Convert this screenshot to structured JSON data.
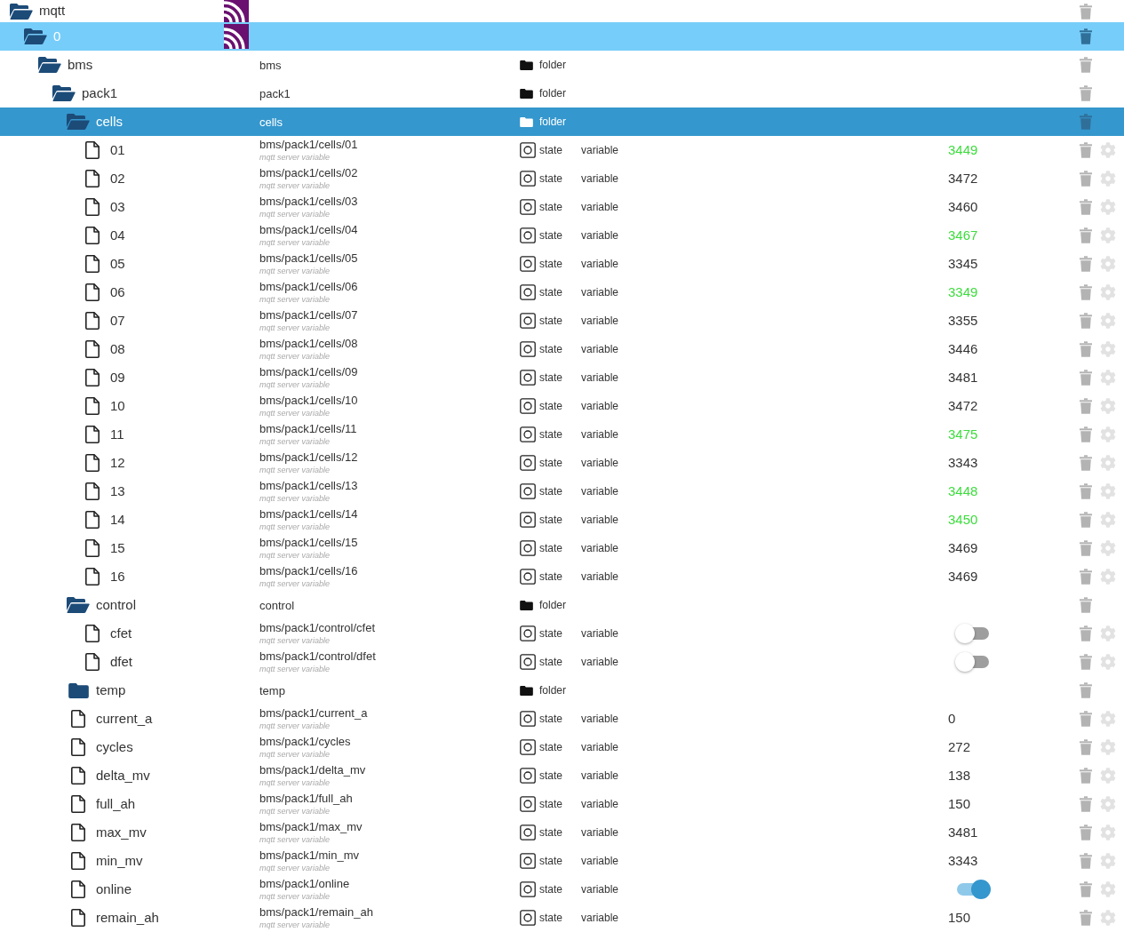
{
  "tree": [
    {
      "name": "mqtt",
      "kind": "adapter",
      "selected": false,
      "expanded": true,
      "children": [
        {
          "name": "0",
          "kind": "instance",
          "selected": false,
          "expanded": true,
          "children": [
            {
              "name": "bms",
              "kind": "folder",
              "selected": false,
              "expanded": true,
              "id": "bms",
              "type": "folder",
              "children": [
                {
                  "name": "pack1",
                  "kind": "folder",
                  "selected": false,
                  "expanded": true,
                  "id": "pack1",
                  "type": "folder",
                  "children": [
                    {
                      "name": "cells",
                      "kind": "folder",
                      "selected": true,
                      "expanded": true,
                      "id": "cells",
                      "type": "folder",
                      "children": [
                        {
                          "name": "01",
                          "kind": "state",
                          "selected": false,
                          "id": "bms/pack1/cells/01",
                          "description": "mqtt server variable",
                          "type": "state",
                          "role": "variable",
                          "value": {
                            "kind": "text",
                            "text": "3449",
                            "highlighted": true
                          }
                        },
                        {
                          "name": "02",
                          "kind": "state",
                          "selected": false,
                          "id": "bms/pack1/cells/02",
                          "description": "mqtt server variable",
                          "type": "state",
                          "role": "variable",
                          "value": {
                            "kind": "text",
                            "text": "3472",
                            "highlighted": false
                          }
                        },
                        {
                          "name": "03",
                          "kind": "state",
                          "selected": false,
                          "id": "bms/pack1/cells/03",
                          "description": "mqtt server variable",
                          "type": "state",
                          "role": "variable",
                          "value": {
                            "kind": "text",
                            "text": "3460",
                            "highlighted": false
                          }
                        },
                        {
                          "name": "04",
                          "kind": "state",
                          "selected": false,
                          "id": "bms/pack1/cells/04",
                          "description": "mqtt server variable",
                          "type": "state",
                          "role": "variable",
                          "value": {
                            "kind": "text",
                            "text": "3467",
                            "highlighted": true
                          }
                        },
                        {
                          "name": "05",
                          "kind": "state",
                          "selected": false,
                          "id": "bms/pack1/cells/05",
                          "description": "mqtt server variable",
                          "type": "state",
                          "role": "variable",
                          "value": {
                            "kind": "text",
                            "text": "3345",
                            "highlighted": false
                          }
                        },
                        {
                          "name": "06",
                          "kind": "state",
                          "selected": false,
                          "id": "bms/pack1/cells/06",
                          "description": "mqtt server variable",
                          "type": "state",
                          "role": "variable",
                          "value": {
                            "kind": "text",
                            "text": "3349",
                            "highlighted": true
                          }
                        },
                        {
                          "name": "07",
                          "kind": "state",
                          "selected": false,
                          "id": "bms/pack1/cells/07",
                          "description": "mqtt server variable",
                          "type": "state",
                          "role": "variable",
                          "value": {
                            "kind": "text",
                            "text": "3355",
                            "highlighted": false
                          }
                        },
                        {
                          "name": "08",
                          "kind": "state",
                          "selected": false,
                          "id": "bms/pack1/cells/08",
                          "description": "mqtt server variable",
                          "type": "state",
                          "role": "variable",
                          "value": {
                            "kind": "text",
                            "text": "3446",
                            "highlighted": false
                          }
                        },
                        {
                          "name": "09",
                          "kind": "state",
                          "selected": false,
                          "id": "bms/pack1/cells/09",
                          "description": "mqtt server variable",
                          "type": "state",
                          "role": "variable",
                          "value": {
                            "kind": "text",
                            "text": "3481",
                            "highlighted": false
                          }
                        },
                        {
                          "name": "10",
                          "kind": "state",
                          "selected": false,
                          "id": "bms/pack1/cells/10",
                          "description": "mqtt server variable",
                          "type": "state",
                          "role": "variable",
                          "value": {
                            "kind": "text",
                            "text": "3472",
                            "highlighted": false
                          }
                        },
                        {
                          "name": "11",
                          "kind": "state",
                          "selected": false,
                          "id": "bms/pack1/cells/11",
                          "description": "mqtt server variable",
                          "type": "state",
                          "role": "variable",
                          "value": {
                            "kind": "text",
                            "text": "3475",
                            "highlighted": true
                          }
                        },
                        {
                          "name": "12",
                          "kind": "state",
                          "selected": false,
                          "id": "bms/pack1/cells/12",
                          "description": "mqtt server variable",
                          "type": "state",
                          "role": "variable",
                          "value": {
                            "kind": "text",
                            "text": "3343",
                            "highlighted": false
                          }
                        },
                        {
                          "name": "13",
                          "kind": "state",
                          "selected": false,
                          "id": "bms/pack1/cells/13",
                          "description": "mqtt server variable",
                          "type": "state",
                          "role": "variable",
                          "value": {
                            "kind": "text",
                            "text": "3448",
                            "highlighted": true
                          }
                        },
                        {
                          "name": "14",
                          "kind": "state",
                          "selected": false,
                          "id": "bms/pack1/cells/14",
                          "description": "mqtt server variable",
                          "type": "state",
                          "role": "variable",
                          "value": {
                            "kind": "text",
                            "text": "3450",
                            "highlighted": true
                          }
                        },
                        {
                          "name": "15",
                          "kind": "state",
                          "selected": false,
                          "id": "bms/pack1/cells/15",
                          "description": "mqtt server variable",
                          "type": "state",
                          "role": "variable",
                          "value": {
                            "kind": "text",
                            "text": "3469",
                            "highlighted": false
                          }
                        },
                        {
                          "name": "16",
                          "kind": "state",
                          "selected": false,
                          "id": "bms/pack1/cells/16",
                          "description": "mqtt server variable",
                          "type": "state",
                          "role": "variable",
                          "value": {
                            "kind": "text",
                            "text": "3469",
                            "highlighted": false
                          }
                        }
                      ]
                    },
                    {
                      "name": "control",
                      "kind": "folder",
                      "selected": false,
                      "expanded": true,
                      "id": "control",
                      "type": "folder",
                      "children": [
                        {
                          "name": "cfet",
                          "kind": "state",
                          "selected": false,
                          "id": "bms/pack1/control/cfet",
                          "description": "mqtt server variable",
                          "type": "state",
                          "role": "variable",
                          "value": {
                            "kind": "switch",
                            "on": false
                          }
                        },
                        {
                          "name": "dfet",
                          "kind": "state",
                          "selected": false,
                          "id": "bms/pack1/control/dfet",
                          "description": "mqtt server variable",
                          "type": "state",
                          "role": "variable",
                          "value": {
                            "kind": "switch",
                            "on": false
                          }
                        }
                      ]
                    },
                    {
                      "name": "temp",
                      "kind": "folder",
                      "selected": false,
                      "expanded": false,
                      "id": "temp",
                      "type": "folder"
                    },
                    {
                      "name": "current_a",
                      "kind": "state",
                      "selected": false,
                      "id": "bms/pack1/current_a",
                      "description": "mqtt server variable",
                      "type": "state",
                      "role": "variable",
                      "value": {
                        "kind": "text",
                        "text": "0",
                        "highlighted": false
                      }
                    },
                    {
                      "name": "cycles",
                      "kind": "state",
                      "selected": false,
                      "id": "bms/pack1/cycles",
                      "description": "mqtt server variable",
                      "type": "state",
                      "role": "variable",
                      "value": {
                        "kind": "text",
                        "text": "272",
                        "highlighted": false
                      }
                    },
                    {
                      "name": "delta_mv",
                      "kind": "state",
                      "selected": false,
                      "id": "bms/pack1/delta_mv",
                      "description": "mqtt server variable",
                      "type": "state",
                      "role": "variable",
                      "value": {
                        "kind": "text",
                        "text": "138",
                        "highlighted": false
                      }
                    },
                    {
                      "name": "full_ah",
                      "kind": "state",
                      "selected": false,
                      "id": "bms/pack1/full_ah",
                      "description": "mqtt server variable",
                      "type": "state",
                      "role": "variable",
                      "value": {
                        "kind": "text",
                        "text": "150",
                        "highlighted": false
                      }
                    },
                    {
                      "name": "max_mv",
                      "kind": "state",
                      "selected": false,
                      "id": "bms/pack1/max_mv",
                      "description": "mqtt server variable",
                      "type": "state",
                      "role": "variable",
                      "value": {
                        "kind": "text",
                        "text": "3481",
                        "highlighted": false
                      }
                    },
                    {
                      "name": "min_mv",
                      "kind": "state",
                      "selected": false,
                      "id": "bms/pack1/min_mv",
                      "description": "mqtt server variable",
                      "type": "state",
                      "role": "variable",
                      "value": {
                        "kind": "text",
                        "text": "3343",
                        "highlighted": false
                      }
                    },
                    {
                      "name": "online",
                      "kind": "state",
                      "selected": false,
                      "id": "bms/pack1/online",
                      "description": "mqtt server variable",
                      "type": "state",
                      "role": "variable",
                      "value": {
                        "kind": "switch",
                        "on": true
                      }
                    },
                    {
                      "name": "remain_ah",
                      "kind": "state",
                      "selected": false,
                      "id": "bms/pack1/remain_ah",
                      "description": "mqtt server variable",
                      "type": "state",
                      "role": "variable",
                      "value": {
                        "kind": "text",
                        "text": "150",
                        "highlighted": false
                      }
                    }
                  ]
                }
              ]
            }
          ]
        }
      ]
    }
  ]
}
